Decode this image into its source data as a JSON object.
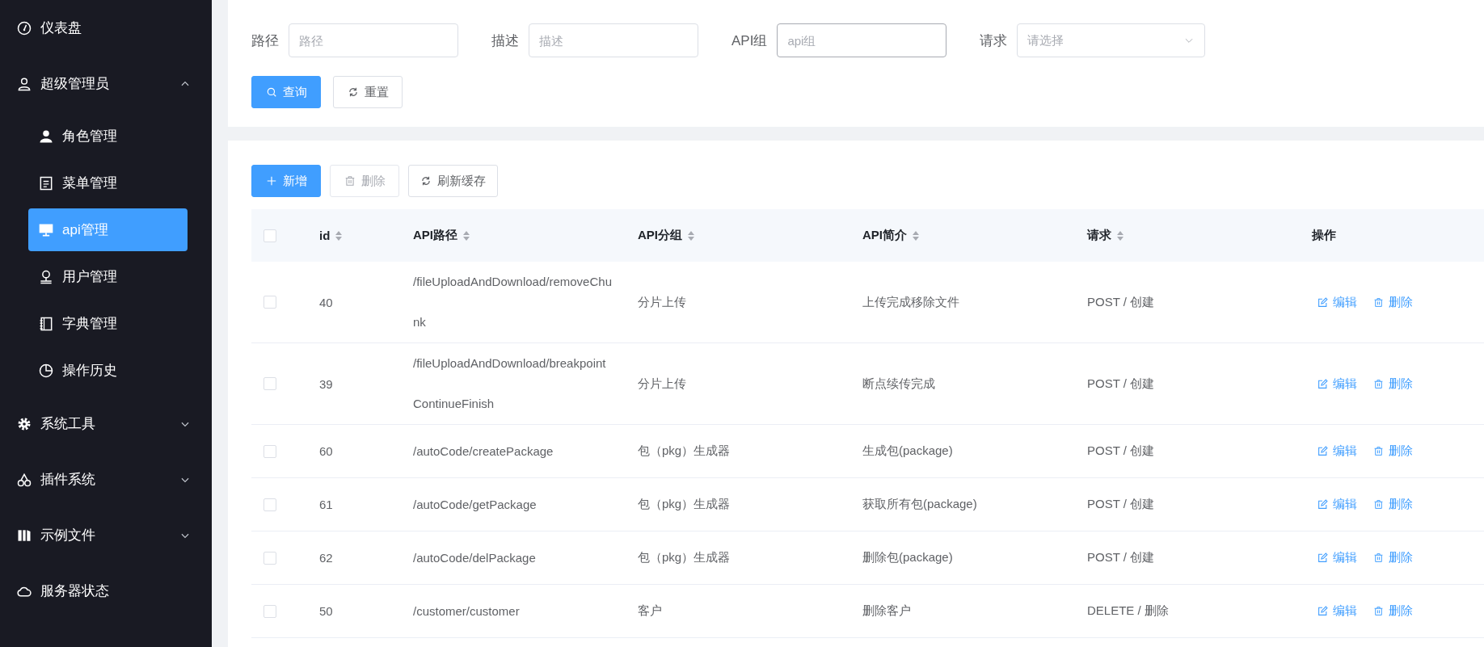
{
  "sidebar": {
    "items": [
      {
        "label": "仪表盘",
        "selected": false
      },
      {
        "label": "超级管理员",
        "selected": false,
        "expanded": true,
        "children": [
          {
            "label": "角色管理",
            "selected": false
          },
          {
            "label": "菜单管理",
            "selected": false
          },
          {
            "label": "api管理",
            "selected": true
          },
          {
            "label": "用户管理",
            "selected": false
          },
          {
            "label": "字典管理",
            "selected": false
          },
          {
            "label": "操作历史",
            "selected": false
          }
        ]
      },
      {
        "label": "系统工具",
        "selected": false,
        "expanded": false
      },
      {
        "label": "插件系统",
        "selected": false,
        "expanded": false
      },
      {
        "label": "示例文件",
        "selected": false,
        "expanded": false
      },
      {
        "label": "服务器状态",
        "selected": false
      }
    ]
  },
  "search_form": {
    "fields": [
      {
        "label": "路径",
        "placeholder": "路径",
        "kind": "input",
        "focused": false
      },
      {
        "label": "描述",
        "placeholder": "描述",
        "kind": "input",
        "focused": false
      },
      {
        "label": "API组",
        "placeholder": "api组",
        "kind": "input",
        "focused": true
      },
      {
        "label": "请求",
        "placeholder": "请选择",
        "kind": "select",
        "focused": false
      }
    ],
    "buttons": [
      {
        "label": "查询",
        "kind": "primary"
      },
      {
        "label": "重置",
        "kind": "default"
      }
    ]
  },
  "toolbar": {
    "buttons": [
      {
        "label": "新增",
        "kind": "primary",
        "disabled": false
      },
      {
        "label": "删除",
        "kind": "default",
        "disabled": true
      },
      {
        "label": "刷新缓存",
        "kind": "default",
        "disabled": false
      }
    ]
  },
  "table": {
    "header_checked": false,
    "columns": [
      {
        "label": "id",
        "sortable": true
      },
      {
        "label": "API路径",
        "sortable": true
      },
      {
        "label": "API分组",
        "sortable": true
      },
      {
        "label": "API简介",
        "sortable": true
      },
      {
        "label": "请求",
        "sortable": true
      },
      {
        "label": "操作",
        "sortable": false
      }
    ],
    "rows": [
      {
        "checked": false,
        "id": "40",
        "path": "/fileUploadAndDownload/removeChunk",
        "group": "分片上传",
        "description": "上传完成移除文件",
        "method": "POST / 创建",
        "actions": [
          "编辑",
          "删除"
        ]
      },
      {
        "checked": false,
        "id": "39",
        "path": "/fileUploadAndDownload/breakpointContinueFinish",
        "group": "分片上传",
        "description": "断点续传完成",
        "method": "POST / 创建",
        "actions": [
          "编辑",
          "删除"
        ]
      },
      {
        "checked": false,
        "id": "60",
        "path": "/autoCode/createPackage",
        "group": "包（pkg）生成器",
        "description": "生成包(package)",
        "method": "POST / 创建",
        "actions": [
          "编辑",
          "删除"
        ]
      },
      {
        "checked": false,
        "id": "61",
        "path": "/autoCode/getPackage",
        "group": "包（pkg）生成器",
        "description": "获取所有包(package)",
        "method": "POST / 创建",
        "actions": [
          "编辑",
          "删除"
        ]
      },
      {
        "checked": false,
        "id": "62",
        "path": "/autoCode/delPackage",
        "group": "包（pkg）生成器",
        "description": "删除包(package)",
        "method": "POST / 创建",
        "actions": [
          "编辑",
          "删除"
        ]
      },
      {
        "checked": false,
        "id": "50",
        "path": "/customer/customer",
        "group": "客户",
        "description": "删除客户",
        "method": "DELETE / 删除",
        "actions": [
          "编辑",
          "删除"
        ]
      }
    ]
  }
}
